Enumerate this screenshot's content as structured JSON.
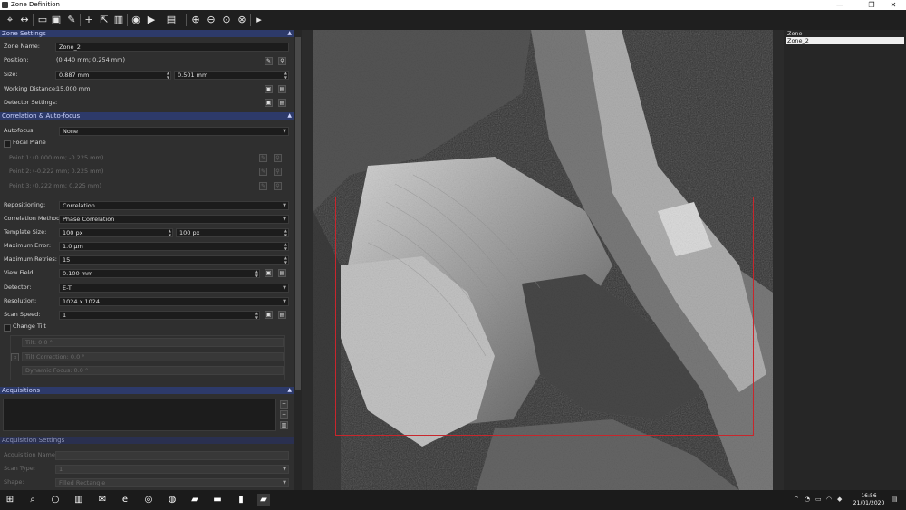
{
  "window": {
    "title": "Zone Definition",
    "minimize": "—",
    "maximize": "❐",
    "close": "✕"
  },
  "zone_settings": {
    "header": "Zone Settings",
    "zone_name_label": "Zone Name:",
    "zone_name_value": "Zone_2",
    "position_label": "Position:",
    "position_value": "(0.440 mm; 0.254 mm)",
    "size_label": "Size:",
    "size_w": "0.887 mm",
    "size_h": "0.501 mm",
    "working_distance_label": "Working Distance:",
    "working_distance_value": "15.000 mm",
    "detector_settings_label": "Detector Settings:"
  },
  "correlation": {
    "header": "Correlation & Auto-focus",
    "autofocus_label": "Autofocus",
    "autofocus_value": "None",
    "focal_plane_label": "Focal Plane",
    "point1_label": "Point 1:",
    "point1_value": "(0.000 mm; -0.225 mm)",
    "point2_label": "Point 2:",
    "point2_value": "(-0.222 mm; 0.225 mm)",
    "point3_label": "Point 3:",
    "point3_value": "(0.222 mm; 0.225 mm)",
    "repositioning_label": "Repositioning:",
    "repositioning_value": "Correlation",
    "method_label": "Correlation Method:",
    "method_value": "Phase Correlation",
    "template_label": "Template Size:",
    "template_w": "100 px",
    "template_h": "100 px",
    "max_error_label": "Maximum Error:",
    "max_error_value": "1.0 µm",
    "max_retries_label": "Maximum Retries:",
    "max_retries_value": "15",
    "view_field_label": "View Field:",
    "view_field_value": "0.100 mm",
    "detector_label": "Detector:",
    "detector_value": "E-T",
    "resolution_label": "Resolution:",
    "resolution_value": "1024 x 1024",
    "scan_speed_label": "Scan Speed:",
    "scan_speed_value": "1",
    "change_tilt_label": "Change Tilt",
    "tilt_value": "Tilt: 0.0 °",
    "tilt_correction_value": "Tilt Correction: 0.0 °",
    "dynamic_focus_value": "Dynamic Focus: 0.0 °"
  },
  "acquisitions": {
    "header": "Acquisitions"
  },
  "acquisition_settings": {
    "header": "Acquisition Settings",
    "name_label": "Acquisition Name:",
    "scan_type_label": "Scan Type:",
    "scan_type_value": "1",
    "shape_label": "Shape:",
    "shape_value": "Filled Rectangle"
  },
  "zones_list": {
    "items": [
      "Zone",
      "Zone_2"
    ],
    "selected": 1
  },
  "taskbar": {
    "time": "16:56",
    "date": "21/01/2020"
  }
}
